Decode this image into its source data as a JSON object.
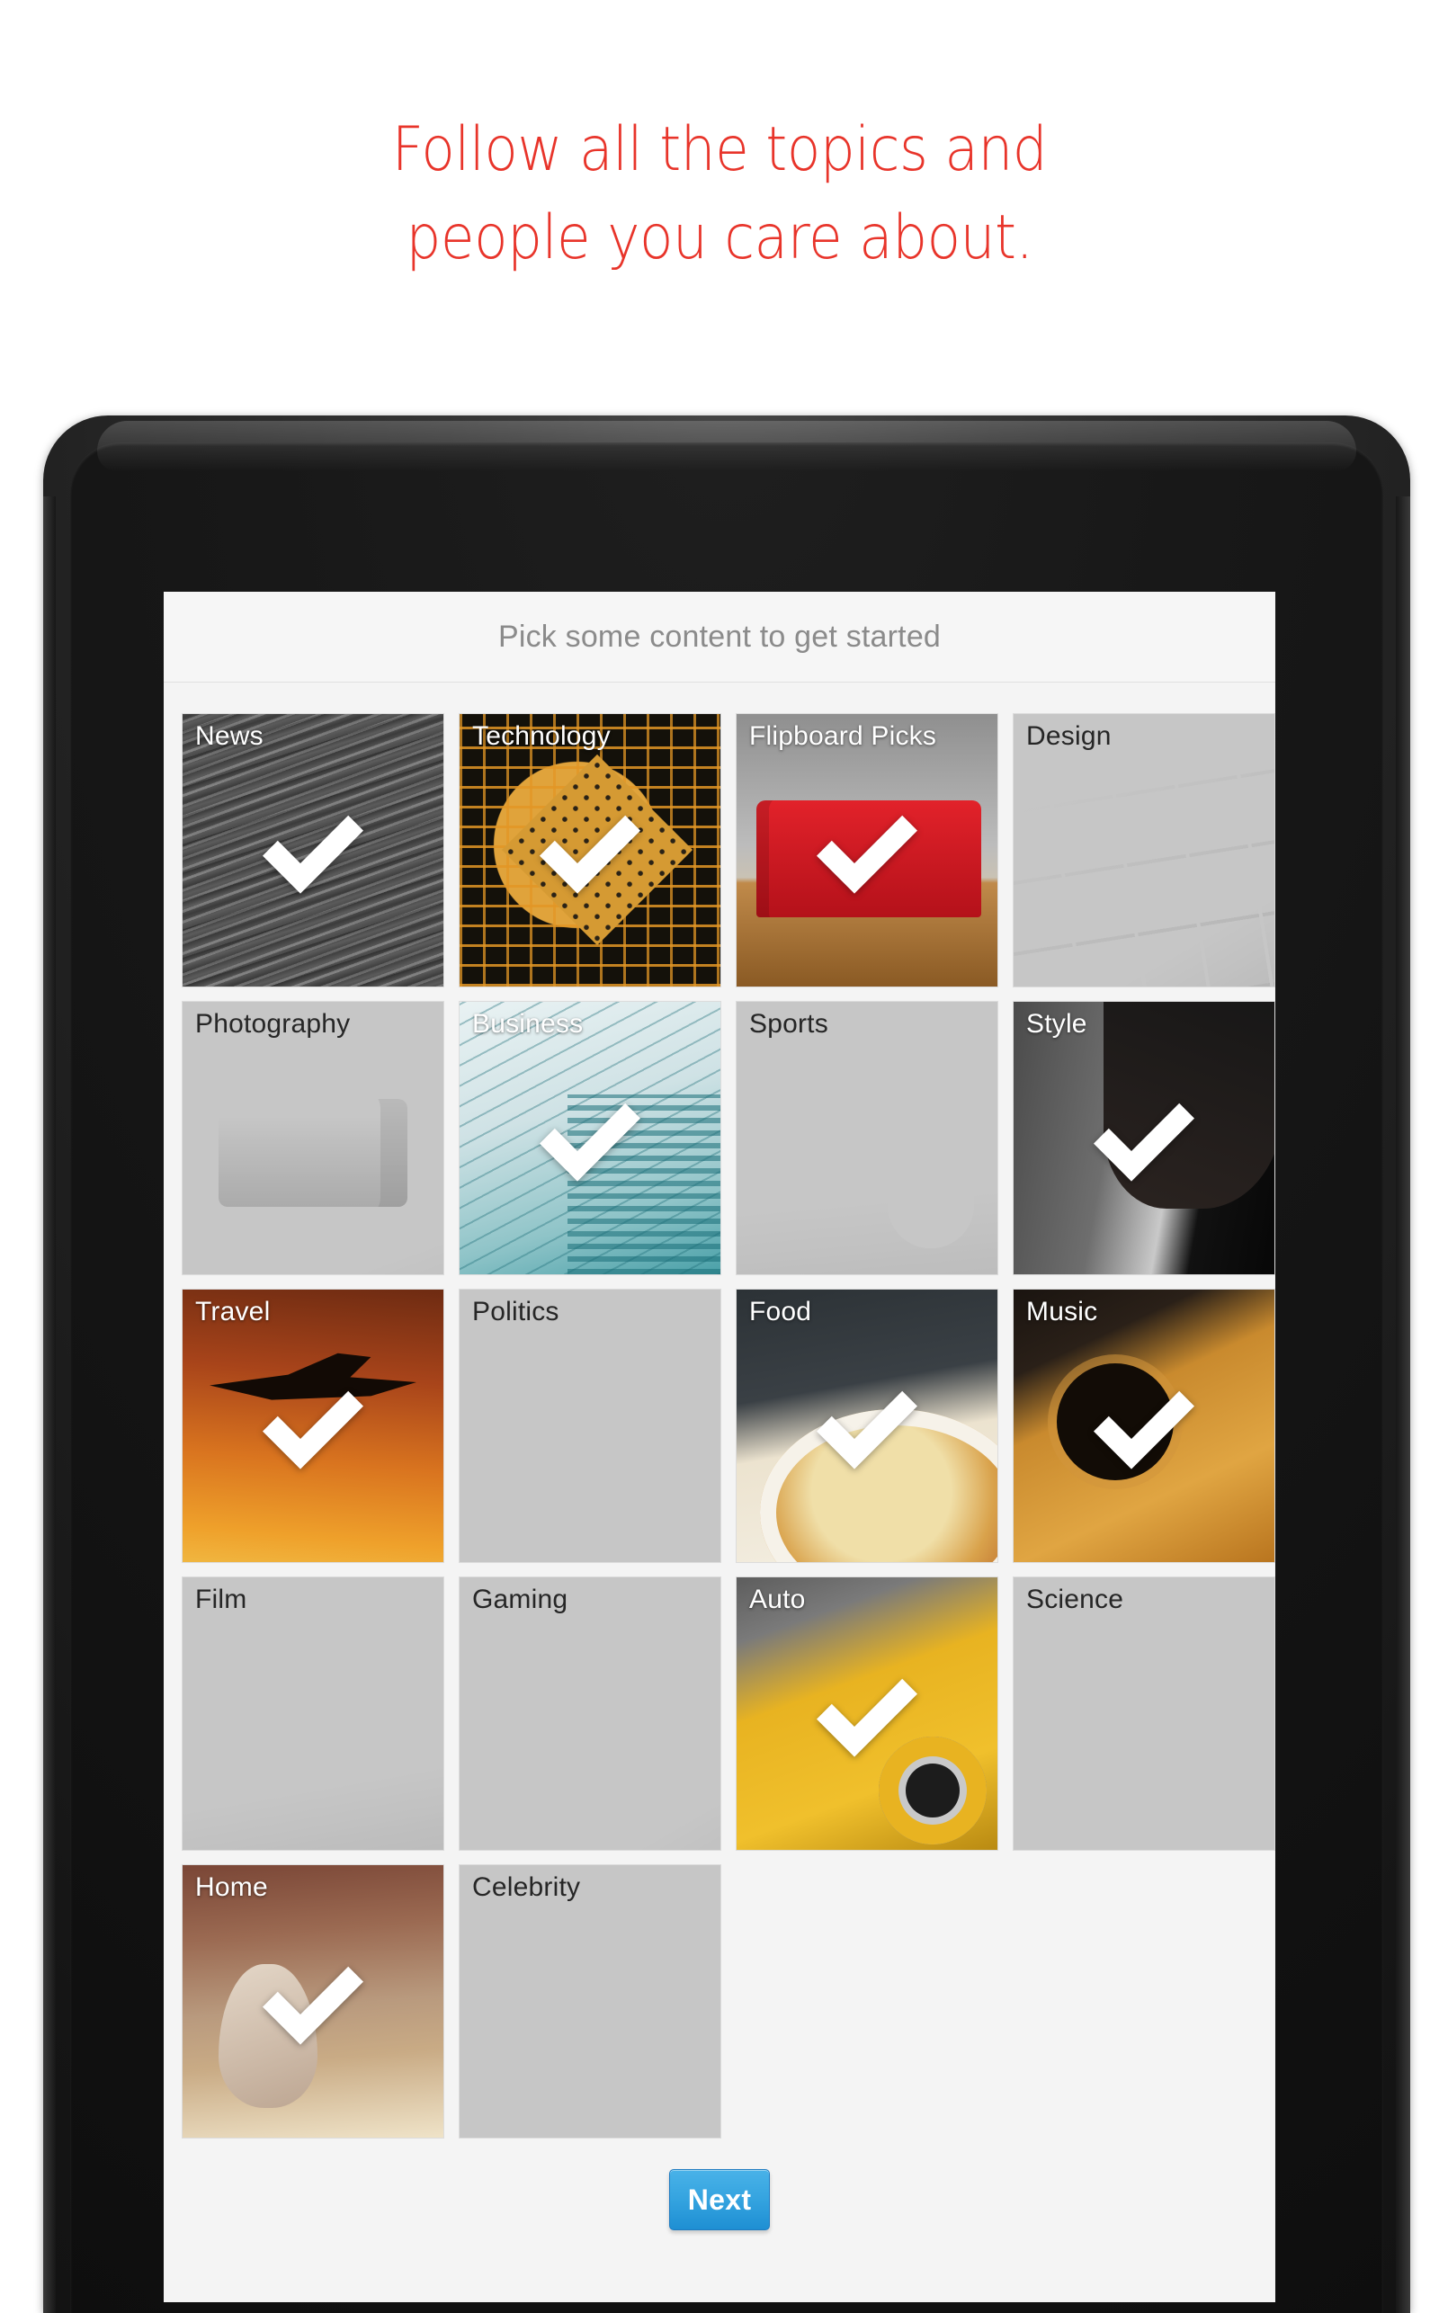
{
  "headline": {
    "line1": "Follow all the topics and",
    "line2": "people you care about.",
    "color": "#e8342a"
  },
  "screen": {
    "header_title": "Pick some content to get started",
    "header_color": "#8b8b8b",
    "background": "#f4f4f4"
  },
  "grid": {
    "columns": 4,
    "tiles": [
      {
        "label": "News",
        "selected": true,
        "art": "news",
        "check": "checkmark-icon"
      },
      {
        "label": "Technology",
        "selected": true,
        "art": "tech",
        "check": "checkmark-icon"
      },
      {
        "label": "Flipboard Picks",
        "selected": true,
        "art": "flipboard",
        "check": "checkmark-icon"
      },
      {
        "label": "Design",
        "selected": false,
        "art": "design",
        "check": ""
      },
      {
        "label": "Photography",
        "selected": false,
        "art": "photography",
        "check": ""
      },
      {
        "label": "Business",
        "selected": true,
        "art": "business",
        "check": "checkmark-icon"
      },
      {
        "label": "Sports",
        "selected": false,
        "art": "sports",
        "check": ""
      },
      {
        "label": "Style",
        "selected": true,
        "art": "style",
        "check": "checkmark-icon"
      },
      {
        "label": "Travel",
        "selected": true,
        "art": "travel",
        "check": "checkmark-icon"
      },
      {
        "label": "Politics",
        "selected": false,
        "art": "politics",
        "check": ""
      },
      {
        "label": "Food",
        "selected": true,
        "art": "food",
        "check": "checkmark-icon"
      },
      {
        "label": "Music",
        "selected": true,
        "art": "music",
        "check": "checkmark-icon"
      },
      {
        "label": "Film",
        "selected": false,
        "art": "film",
        "check": ""
      },
      {
        "label": "Gaming",
        "selected": false,
        "art": "gaming",
        "check": ""
      },
      {
        "label": "Auto",
        "selected": true,
        "art": "auto",
        "check": "checkmark-icon"
      },
      {
        "label": "Science",
        "selected": false,
        "art": "science",
        "check": ""
      },
      {
        "label": "Home",
        "selected": true,
        "art": "home",
        "check": "checkmark-icon"
      },
      {
        "label": "Celebrity",
        "selected": false,
        "art": "celebrity",
        "check": ""
      }
    ]
  },
  "footer": {
    "next_label": "Next",
    "next_color": "#35a4e0"
  },
  "device": {
    "bezel_color": "#161616"
  }
}
